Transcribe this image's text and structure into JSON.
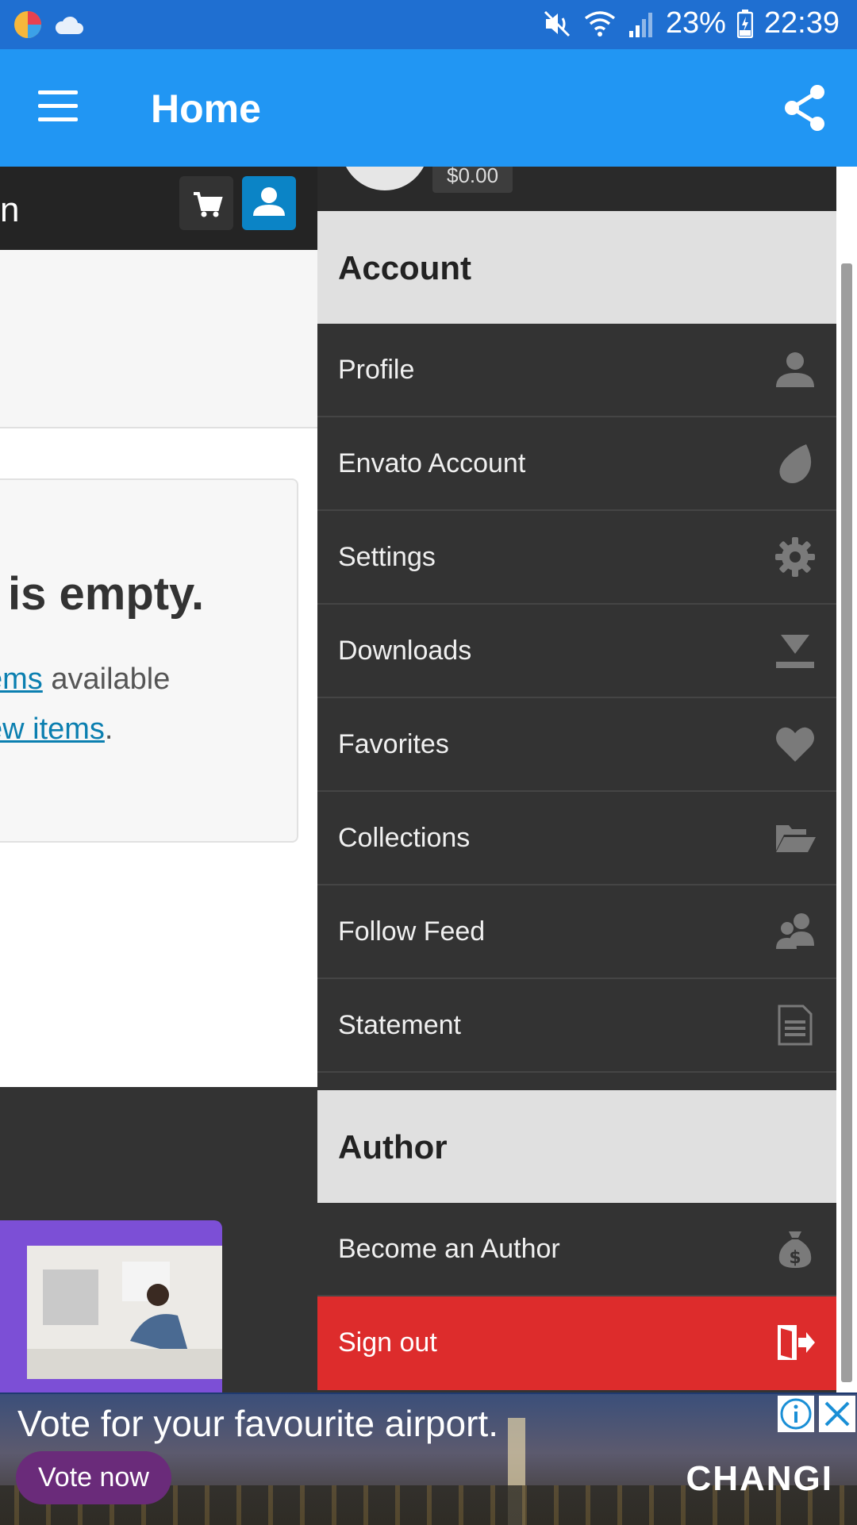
{
  "status_bar": {
    "battery": "23%",
    "time": "22:39",
    "icons": [
      "app-icon",
      "cloud-icon",
      "mute-icon",
      "wifi-icon",
      "signal-icon",
      "battery-icon"
    ]
  },
  "app_bar": {
    "title": "Home",
    "menu_icon": "hamburger-icon",
    "share_icon": "share-icon"
  },
  "page": {
    "header_text": "n",
    "cart_icon": "cart-icon",
    "user_icon": "user-icon",
    "empty_title": "is empty.",
    "line1_link": "ems",
    "line1_rest": " available",
    "line2_link": "ew items",
    "line2_rest": "."
  },
  "drawer": {
    "balance": "$0.00",
    "sections": [
      {
        "heading": "Account",
        "items": [
          {
            "label": "Profile",
            "icon": "user-icon"
          },
          {
            "label": "Envato Account",
            "icon": "envato-leaf-icon"
          },
          {
            "label": "Settings",
            "icon": "gear-icon"
          },
          {
            "label": "Downloads",
            "icon": "download-icon"
          },
          {
            "label": "Favorites",
            "icon": "heart-icon"
          },
          {
            "label": "Collections",
            "icon": "folder-open-icon"
          },
          {
            "label": "Follow Feed",
            "icon": "users-icon"
          },
          {
            "label": "Statement",
            "icon": "document-icon"
          }
        ]
      },
      {
        "heading": "Author",
        "items": [
          {
            "label": "Become an Author",
            "icon": "money-bag-icon"
          },
          {
            "label": "Sign out",
            "icon": "sign-out-icon"
          }
        ]
      }
    ]
  },
  "ad": {
    "headline": "Vote for your favourite airport.",
    "cta": "Vote now",
    "brand": "CHANGI",
    "info_icon": "info-icon",
    "close_icon": "close-icon"
  },
  "colors": {
    "status_bar": "#1f6fd1",
    "app_bar": "#2196f3",
    "drawer_bg": "#333333",
    "section_bg": "#e0e0e0",
    "sign_out": "#dd2c2c",
    "link": "#0b7fb0"
  }
}
